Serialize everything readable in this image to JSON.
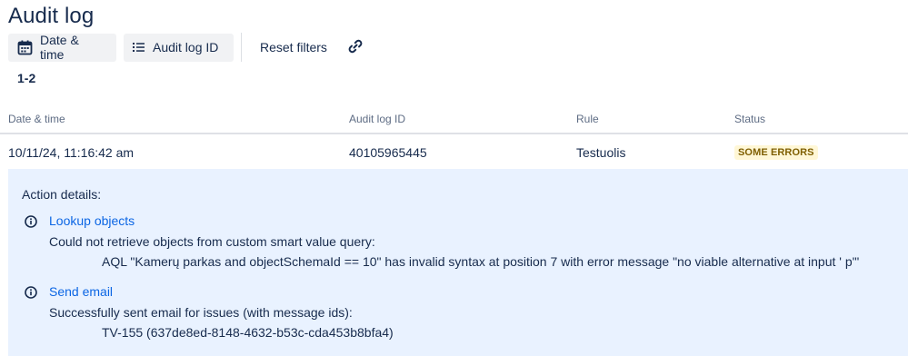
{
  "page": {
    "title": "Audit log"
  },
  "toolbar": {
    "date_time_label": "Date & time",
    "audit_log_id_label": "Audit log ID",
    "reset_filters_label": "Reset filters"
  },
  "results": {
    "count_label": "1-2"
  },
  "table": {
    "headers": {
      "date_time": "Date & time",
      "audit_log_id": "Audit log ID",
      "rule": "Rule",
      "status": "Status"
    },
    "rows": [
      {
        "date_time": "10/11/24, 11:16:42 am",
        "audit_log_id": "40105965445",
        "rule": "Testuolis",
        "status": "SOME ERRORS"
      }
    ]
  },
  "details": {
    "title": "Action details:",
    "actions": [
      {
        "name": "Lookup objects",
        "message": "Could not retrieve objects from custom smart value query:",
        "detail": "AQL \"Kamerų parkas and objectSchemaId == 10\" has invalid syntax at position 7 with error message \"no viable alternative at input ' p'\""
      },
      {
        "name": "Send email",
        "message": "Successfully sent email for issues (with message ids):",
        "detail": "TV-155 (637de8ed-8148-4632-b53c-cda453b8bfa4)"
      }
    ]
  },
  "colors": {
    "status_badge_bg": "#fff7d6",
    "status_badge_text": "#7f5f01",
    "details_bg": "#e9f2ff",
    "link": "#0c66e4"
  },
  "icons": {
    "date_time": "calendar-icon",
    "audit_log_id": "list-icon",
    "copy_link": "link-icon",
    "action_info": "info-icon"
  }
}
